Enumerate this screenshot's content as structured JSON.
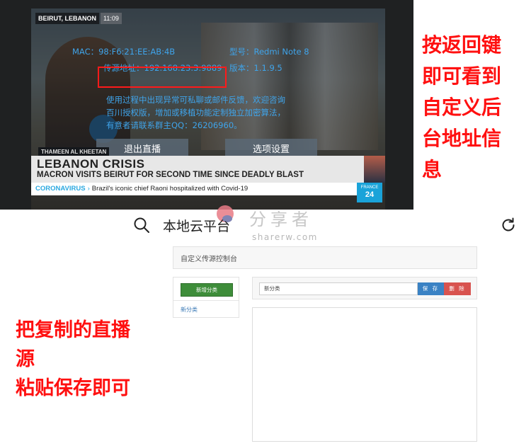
{
  "tv": {
    "location": "BEIRUT, LEBANON",
    "time": "11:09",
    "mac": "MAC：98:F6:21:EE:AB:4B",
    "model": "型号：Redmi Note 8",
    "source_address": "传源地址：192.168.23.3:9889",
    "version": "版本：1.1.9.5",
    "notice_lines": [
      "使用过程中出现异常可私聊或邮件反馈，欢迎咨询",
      "百川授权版，增加或移植功能定制独立加密算法，",
      "有意者请联系群主QQ：26206960。"
    ],
    "exit_button": "退出直播",
    "options_button": "选项设置",
    "nameplate": "THAMEEN AL KHEETAN",
    "headline": "LEBANON CRISIS",
    "subheadline": "MACRON VISITS BEIRUT FOR SECOND TIME SINCE DEADLY BLAST",
    "ticker_tag": "CORONAVIRUS",
    "ticker_arrow": "›",
    "ticker_text": "Brazil's iconic chief Raoni hospitalized with Covid-19",
    "channel_logo_top": "FRANCE",
    "channel_logo_num": "24"
  },
  "captions": {
    "right_lines": [
      "按返回键",
      "即可看到",
      "自定义后",
      "台地址信",
      "息"
    ],
    "left_lines": [
      "把复制的直播",
      "源",
      "粘贴保存即可"
    ]
  },
  "web": {
    "title": "本地云平台",
    "watermark_cn": "分享者",
    "watermark_en": "sharerw.com",
    "console_title": "自定义传源控制台",
    "new_category_button": "新增分类",
    "category_item": "新分类",
    "category_name_value": "新分类",
    "save_button": "保 存",
    "delete_button": "删 除",
    "editor_content": ""
  },
  "colors": {
    "caption_red": "#ff1010",
    "tv_text_blue": "#3fa4ea",
    "highlight_box": "#ff1a1a",
    "button_green": "#3e8d3a",
    "button_blue": "#3a82c4",
    "button_red": "#d8534f"
  }
}
